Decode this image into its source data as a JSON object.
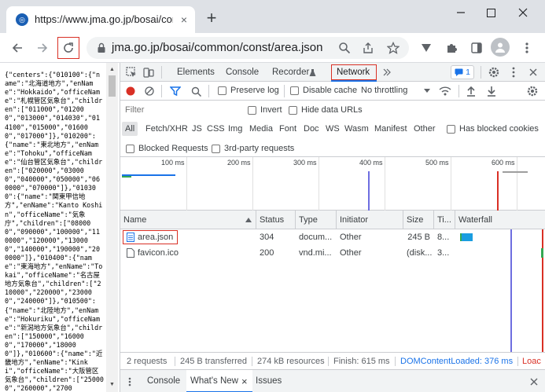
{
  "browser": {
    "tab_title": "https://www.jma.go.jp/bosai/com",
    "tab_close": "×",
    "new_tab": "+",
    "favicon_letter": "◎",
    "url": "jma.go.jp/bosai/common/const/area.json"
  },
  "page": {
    "json_text": "{\"centers\":{\"010100\":{\"name\":\"北海道地方\",\"enName\":\"Hokkaido\",\"officeName\":\"札幌管区気象台\",\"children\":[\"011000\",\"012000\",\"013000\",\"014030\",\"014100\",\"015000\",\"016000\",\"017000\"]},\"010200\":{\"name\":\"東北地方\",\"enName\":\"Tohoku\",\"officeName\":\"仙台管区気象台\",\"children\":[\"020000\",\"030000\",\"040000\",\"050000\",\"060000\",\"070000\"]},\"010300\":{\"name\":\"関東甲信地方\",\"enName\":\"Kanto Koshin\",\"officeName\":\"気象庁\",\"children\":[\"080000\",\"090000\",\"100000\",\"110000\",\"120000\",\"130000\",\"140000\",\"190000\",\"200000\"]},\"010400\":{\"name\":\"東海地方\",\"enName\":\"Tokai\",\"officeName\":\"名古屋地方気象台\",\"children\":[\"210000\",\"220000\",\"230000\",\"240000\"]},\"010500\":{\"name\":\"北陸地方\",\"enName\":\"Hokuriku\",\"officeName\":\"新潟地方気象台\",\"children\":[\"150000\",\"160000\",\"170000\",\"180000\"]},\"010600\":{\"name\":\"近畿地方\",\"enName\":\"Kinki\",\"officeName\":\"大阪管区気象台\",\"children\":[\"250000\",\"260000\",\"2700"
  },
  "devtools": {
    "tabs": [
      "Elements",
      "Console",
      "Recorder",
      "Network"
    ],
    "issues_count": "1",
    "filter_placeholder": "Filter",
    "preserve_log": "Preserve log",
    "disable_cache": "Disable cache",
    "throttling": "No throttling",
    "invert": "Invert",
    "hide_data_urls": "Hide data URLs",
    "filter_types": [
      "All",
      "Fetch/XHR",
      "JS",
      "CSS",
      "Img",
      "Media",
      "Font",
      "Doc",
      "WS",
      "Wasm",
      "Manifest",
      "Other"
    ],
    "has_blocked_cookies": "Has blocked cookies",
    "blocked_requests": "Blocked Requests",
    "third_party": "3rd-party requests",
    "overview_ticks": [
      "100 ms",
      "200 ms",
      "300 ms",
      "400 ms",
      "500 ms",
      "600 ms"
    ],
    "columns": [
      "Name",
      "Status",
      "Type",
      "Initiator",
      "Size",
      "Ti...",
      "Waterfall"
    ],
    "rows": [
      {
        "name": "area.json",
        "status": "304",
        "type": "docum...",
        "initiator": "Other",
        "size": "245 B",
        "time": "8..."
      },
      {
        "name": "favicon.ico",
        "status": "200",
        "type": "vnd.mi...",
        "initiator": "Other",
        "size": "(disk...",
        "time": "3..."
      }
    ],
    "status": {
      "requests": "2 requests",
      "transferred": "245 B transferred",
      "resources": "274 kB resources",
      "finish": "Finish: 615 ms",
      "dcl": "DOMContentLoaded: 376 ms",
      "load": "Loac"
    },
    "drawer": {
      "console": "Console",
      "whats_new": "What's New",
      "close": "×",
      "issues": "Issues"
    }
  },
  "colors": {
    "accent_blue": "#1a73e8",
    "record_red": "#d93025",
    "highlight_box": "#d93025",
    "dcl_blue": "#1a73e8",
    "load_red": "#d93025"
  }
}
